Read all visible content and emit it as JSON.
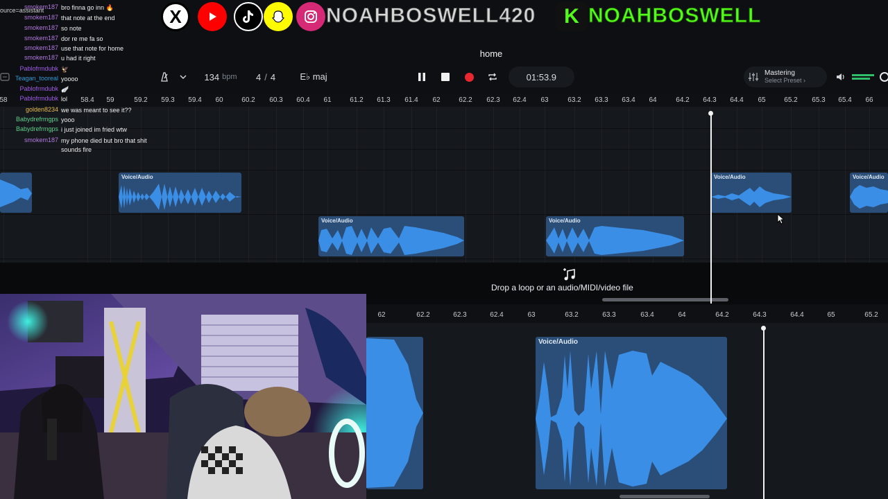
{
  "daw": {
    "project_title": "home",
    "bpm": "134",
    "bpm_unit": "bpm",
    "time_sig_top": "4",
    "time_sig_sep": "/",
    "time_sig_bottom": "4",
    "key": "E♭ maj",
    "time_display": "01:53.9",
    "mastering_label": "Mastering",
    "mastering_preset": "Select Preset",
    "mastering_chevron": "›",
    "drop_text": "Drop a loop or an audio/MIDI/video file",
    "clip_label": "Voice/Audio",
    "accent_color": "#3b8ee6",
    "record_color": "#e8272f",
    "icons": {
      "metronome": "metronome-icon",
      "dropdown": "chevron-down-icon",
      "pause": "pause-icon",
      "stop": "stop-icon",
      "record": "record-icon",
      "loop": "loop-icon",
      "mixer": "sliders-icon",
      "volume": "speaker-icon",
      "drop": "music-note-plus-icon"
    }
  },
  "ruler_top": [
    "58",
    "58.4",
    "59",
    "59.2",
    "59.3",
    "59.4",
    "60",
    "60.2",
    "60.3",
    "60.4",
    "61",
    "61.2",
    "61.3",
    "61.4",
    "62",
    "62.2",
    "62.3",
    "62.4",
    "63",
    "63.2",
    "63.3",
    "63.4",
    "64",
    "64.2",
    "64.3",
    "64.4",
    "65",
    "65.2",
    "65.3",
    "65.4",
    "66"
  ],
  "ruler_bottom": [
    "62",
    "62.2",
    "62.3",
    "62.4",
    "63",
    "63.2",
    "63.3",
    "63.4",
    "64",
    "64.2",
    "64.3",
    "64.4",
    "65",
    "65.2"
  ],
  "social": {
    "x_letter": "X",
    "handle_main": "NOAHBOSWELL420",
    "kick_letter": "K",
    "handle_kick": "NOAHBOSWELL",
    "colors": {
      "youtube": "#ff0000",
      "snapchat": "#fffc00",
      "kick": "#53fc18"
    }
  },
  "source_label": "ource=assistant",
  "chat": [
    {
      "user": "smokem187",
      "msg": "bro finna go inn 🔥",
      "color": "#b47ae0"
    },
    {
      "user": "smokem187",
      "msg": "that note at the end",
      "color": "#b47ae0"
    },
    {
      "user": "smokem187",
      "msg": "so note",
      "color": "#b47ae0"
    },
    {
      "user": "smokem187",
      "msg": "dor re me fa so",
      "color": "#b47ae0"
    },
    {
      "user": "smokem187",
      "msg": "use that note for home",
      "color": "#b47ae0"
    },
    {
      "user": "smokem187",
      "msg": "u had it right",
      "color": "#b47ae0"
    },
    {
      "user": "Pablofrmdubk",
      "msg": "🦅",
      "color": "#a05ce8"
    },
    {
      "user": "Teagan_tooreal",
      "msg": "yoooo",
      "color": "#2f9bd8"
    },
    {
      "user": "Pablofrmdubk",
      "msg": "🪽",
      "color": "#a05ce8"
    },
    {
      "user": "Pablofrmdubk",
      "msg": "lol",
      "color": "#a05ce8"
    },
    {
      "user": "golden8234",
      "msg": "we was meant to see it??",
      "color": "#e8b84a"
    },
    {
      "user": "Babydrefrmgps",
      "msg": "yooo",
      "color": "#5fd18c"
    },
    {
      "user": "Babydrefrmgps",
      "msg": "i just joined im fried wtw",
      "color": "#5fd18c"
    },
    {
      "user": "smokem187",
      "msg": "my phone died but bro that shit sounds fire",
      "color": "#b47ae0"
    }
  ]
}
